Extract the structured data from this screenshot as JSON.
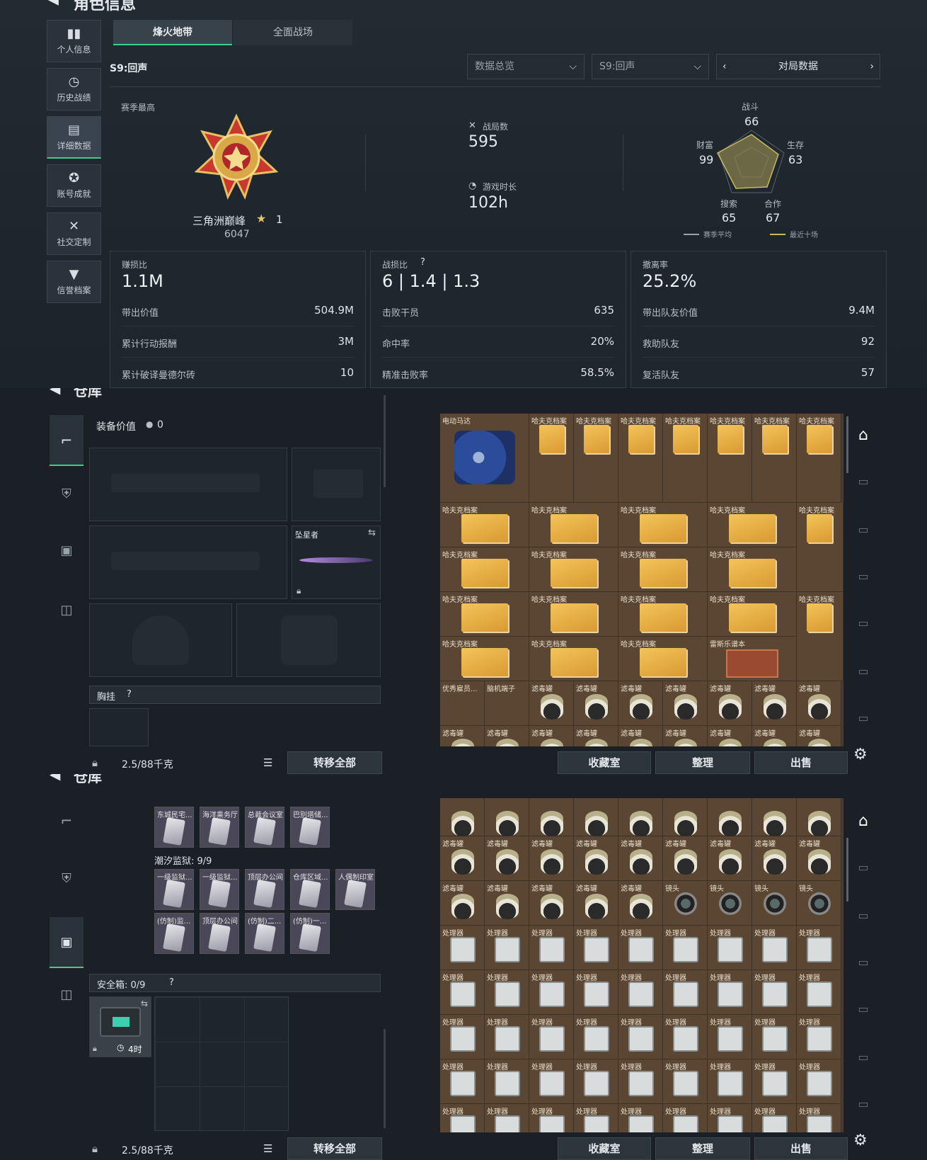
{
  "profile": {
    "header": "角色信息",
    "side": [
      "个人信息",
      "历史战绩",
      "详细数据",
      "账号成就",
      "社交定制",
      "信誉档案"
    ],
    "tabs": [
      "烽火地带",
      "全面战场"
    ],
    "season": "S9:回声",
    "dropdowns": [
      "数据总览",
      "S9:回声"
    ],
    "nav_label": "对局数据",
    "season_best": "赛季最高",
    "rank_name": "三角洲巅峰",
    "rank_stars": "1",
    "rank_score": "6047",
    "matches_label": "战局数",
    "matches": "595",
    "playtime_label": "游戏时长",
    "playtime": "102h",
    "radar": {
      "labels": [
        "战斗",
        "生存",
        "合作",
        "搜索",
        "财富"
      ],
      "values": [
        "66",
        "63",
        "67",
        "65",
        "99"
      ],
      "legend": [
        "赛季平均",
        "最近十场"
      ]
    },
    "cards": [
      {
        "title": "赚损比",
        "value": "1.1M",
        "rows": [
          [
            "带出价值",
            "504.9M"
          ],
          [
            "累计行动报酬",
            "3M"
          ],
          [
            "累计破译曼德尔砖",
            "10"
          ]
        ]
      },
      {
        "title": "战损比",
        "value": "6 | 1.4 | 1.3",
        "rows": [
          [
            "击败干员",
            "635"
          ],
          [
            "命中率",
            "20%"
          ],
          [
            "精准击败率",
            "58.5%"
          ]
        ]
      },
      {
        "title": "撤离率",
        "value": "25.2%",
        "rows": [
          [
            "带出队友价值",
            "9.4M"
          ],
          [
            "救助队友",
            "92"
          ],
          [
            "复活队友",
            "57"
          ]
        ]
      }
    ]
  },
  "storage1": {
    "header": "仓库",
    "equip_value_label": "装备价值",
    "equip_value": "0",
    "melee_name": "坠星者",
    "chest_label": "胸挂",
    "weight": "2.5/88千克",
    "transfer_all": "转移全部",
    "bottom_buttons": [
      "收藏室",
      "整理",
      "出售"
    ],
    "first_item": "电动马达",
    "folder_name": "哈夫克档案",
    "filter_name": "滤毒罐",
    "row6": [
      "优秀雇员...",
      "脑机端子"
    ],
    "rhodes": "雷斯乐谱本"
  },
  "storage2": {
    "header": "仓库",
    "keys_row1": [
      "东城民宅...",
      "海洋乘务厅",
      "总裁会议室",
      "巴别塔储..."
    ],
    "tidal_label": "潮汐监狱: 9/9",
    "keys_row2": [
      "一级监狱...",
      "一级监狱...",
      "顶层办公间",
      "仓库区域...",
      "人偶制印室"
    ],
    "keys_row3": [
      "(仿制)监...",
      "顶层办公间",
      "(仿制)二...",
      "(仿制)一..."
    ],
    "safe_label": "安全箱: 0/9",
    "safe_timer": "4时",
    "weight": "2.5/88千克",
    "transfer_all": "转移全部",
    "bottom_buttons": [
      "收藏室",
      "整理",
      "出售"
    ],
    "filter_name": "滤毒罐",
    "lens_name": "镜头",
    "proc_name": "处理器"
  },
  "colors": {
    "accent_green": "#3bd08a",
    "item_brown": "#5a4632",
    "gold": "#f3c45a"
  }
}
